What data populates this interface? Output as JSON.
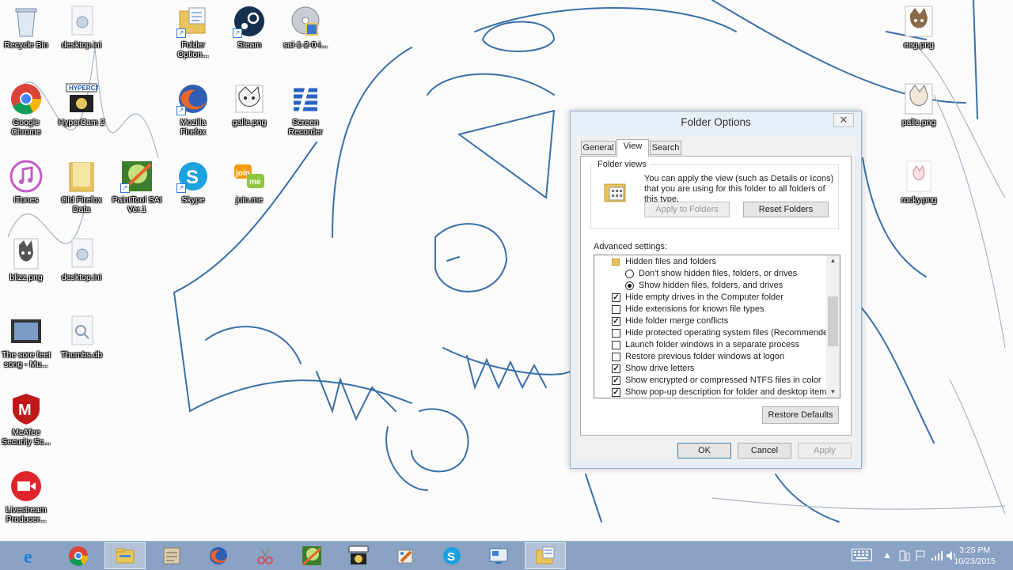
{
  "desktop": {
    "icons": [
      {
        "label": "Recycle Bin",
        "icon": "recycle-bin-icon"
      },
      {
        "label": "desktop.ini",
        "icon": "settings-file-icon"
      },
      {
        "label": "Folder\nOption...",
        "icon": "folder-options-icon"
      },
      {
        "label": "Steam",
        "icon": "steam-icon"
      },
      {
        "label": "sai-1-2-0-i...",
        "icon": "disc-installer-icon"
      },
      {
        "label": "Google\nChrome",
        "icon": "chrome-icon"
      },
      {
        "label": "HyperCam 2",
        "icon": "hypercam-icon"
      },
      {
        "label": "Mozilla\nFirefox",
        "icon": "firefox-icon"
      },
      {
        "label": "galle.png",
        "icon": "image-file-icon"
      },
      {
        "label": "Screen\nRecorder",
        "icon": "screen-recorder-icon"
      },
      {
        "label": "iTunes",
        "icon": "itunes-icon"
      },
      {
        "label": "Old Firefox\nData",
        "icon": "folder-icon"
      },
      {
        "label": "PaintTool SAI\nVer.1",
        "icon": "painttool-sai-icon"
      },
      {
        "label": "Skype",
        "icon": "skype-icon"
      },
      {
        "label": "join.me",
        "icon": "joinme-icon"
      },
      {
        "label": "blizz.png",
        "icon": "image-file-icon"
      },
      {
        "label": "desktop.ini",
        "icon": "settings-file-icon"
      },
      {
        "label": "The sore feet\nsong - Mu...",
        "icon": "video-file-icon"
      },
      {
        "label": "Thumbs.db",
        "icon": "database-file-icon"
      },
      {
        "label": "McAfee\nSecurity Sc...",
        "icon": "mcafee-icon"
      },
      {
        "label": "Livestream\nProducer...",
        "icon": "livestream-icon"
      },
      {
        "label": "eag.png",
        "icon": "image-file-icon"
      },
      {
        "label": "palle.png",
        "icon": "image-file-icon"
      },
      {
        "label": "rocky.png",
        "icon": "image-file-icon"
      }
    ]
  },
  "dialog": {
    "title": "Folder Options",
    "close_glyph": "✕",
    "tabs": [
      "General",
      "View",
      "Search"
    ],
    "active_tab": "View",
    "folder_views": {
      "group_title": "Folder views",
      "description": "You can apply the view (such as Details or Icons) that you are using for this folder to all folders of this type.",
      "apply_button": "Apply to Folders",
      "reset_button": "Reset Folders"
    },
    "advanced_label": "Advanced settings:",
    "advanced_items": [
      {
        "type": "folder",
        "label": "Hidden files and folders"
      },
      {
        "type": "radio",
        "label": "Don't show hidden files, folders, or drives",
        "checked": false
      },
      {
        "type": "radio",
        "label": "Show hidden files, folders, and drives",
        "checked": true
      },
      {
        "type": "checkbox",
        "label": "Hide empty drives in the Computer folder",
        "checked": true
      },
      {
        "type": "checkbox",
        "label": "Hide extensions for known file types",
        "checked": false
      },
      {
        "type": "checkbox",
        "label": "Hide folder merge conflicts",
        "checked": true
      },
      {
        "type": "checkbox",
        "label": "Hide protected operating system files (Recommended)",
        "checked": false
      },
      {
        "type": "checkbox",
        "label": "Launch folder windows in a separate process",
        "checked": false
      },
      {
        "type": "checkbox",
        "label": "Restore previous folder windows at logon",
        "checked": false
      },
      {
        "type": "checkbox",
        "label": "Show drive letters",
        "checked": true
      },
      {
        "type": "checkbox",
        "label": "Show encrypted or compressed NTFS files in color",
        "checked": true
      },
      {
        "type": "checkbox",
        "label": "Show pop-up description for folder and desktop items",
        "checked": true
      }
    ],
    "restore_defaults_button": "Restore Defaults",
    "ok_button": "OK",
    "cancel_button": "Cancel",
    "apply_button": "Apply"
  },
  "taskbar": {
    "apps": [
      {
        "icon": "internet-explorer-icon",
        "color": "#1e7fd6"
      },
      {
        "icon": "chrome-icon",
        "color": "#e04a3b"
      },
      {
        "icon": "file-explorer-icon",
        "color": "#e8c45a"
      },
      {
        "icon": "control-panel-icon",
        "color": "#b8a98a"
      },
      {
        "icon": "firefox-icon",
        "color": "#e8662b"
      },
      {
        "icon": "snipping-tool-icon",
        "color": "#d9495b"
      },
      {
        "icon": "painttool-sai-icon",
        "color": "#4a8c3a"
      },
      {
        "icon": "hypercam-icon",
        "color": "#2b2b2b"
      },
      {
        "icon": "paint-icon",
        "color": "#d56b2a"
      },
      {
        "icon": "skype-icon",
        "color": "#1aa1e0"
      },
      {
        "icon": "screen-recorder-icon",
        "color": "#3a7bd5"
      },
      {
        "icon": "folder-options-icon",
        "color": "#e8c45a"
      }
    ],
    "clock_time": "3:25 PM",
    "clock_date": "10/23/2015"
  }
}
